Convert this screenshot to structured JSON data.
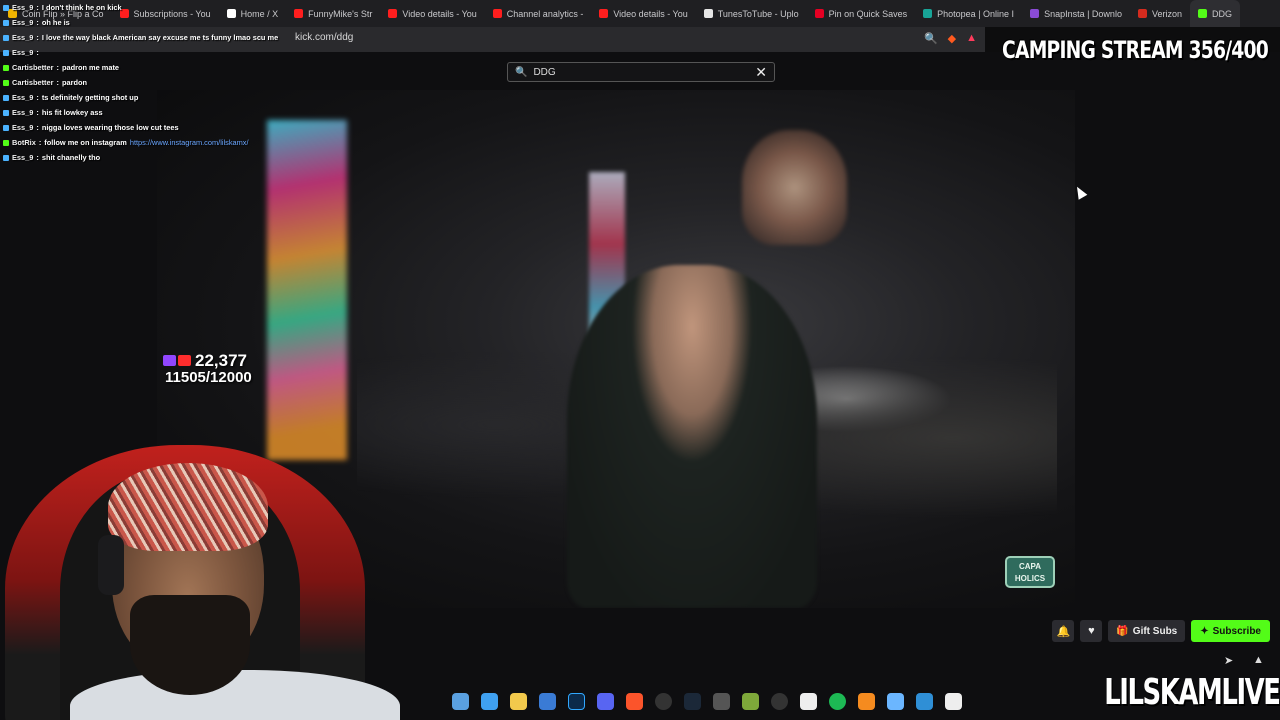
{
  "browser": {
    "tabs": [
      {
        "label": "Coin Flip » Flip a Co",
        "color": "#f0b400"
      },
      {
        "label": "Subscriptions - You",
        "color": "#ff1e1e"
      },
      {
        "label": "Home / X",
        "color": "#ffffff"
      },
      {
        "label": "FunnyMike's Str",
        "color": "#ff1e1e"
      },
      {
        "label": "Video details - You",
        "color": "#ff1e1e"
      },
      {
        "label": "Channel analytics -",
        "color": "#ff1e1e"
      },
      {
        "label": "Video details - You",
        "color": "#ff1e1e"
      },
      {
        "label": "TunesToTube - Uplo",
        "color": "#e6e6e6"
      },
      {
        "label": "Pin on Quick Saves",
        "color": "#e60023"
      },
      {
        "label": "Photopea | Online I",
        "color": "#18a497"
      },
      {
        "label": "SnapInsta | Downlo",
        "color": "#8a4bd6"
      },
      {
        "label": "Verizon",
        "color": "#d52b1e"
      },
      {
        "label": "DDG",
        "color": "#53fc18"
      }
    ],
    "url": "kick.com/ddg"
  },
  "search": {
    "value": "DDG"
  },
  "chat": {
    "messages": [
      {
        "user": "Ess_9",
        "text": "I don't think he on kick",
        "badge": "#4bb3ff"
      },
      {
        "user": "Ess_9",
        "text": "oh he is",
        "badge": "#4bb3ff"
      },
      {
        "user": "Ess_9",
        "text": "I love the way black American say excuse me ts funny lmao scu me",
        "badge": "#4bb3ff"
      },
      {
        "user": "Ess_9",
        "text": "",
        "badge": "#4bb3ff"
      },
      {
        "user": "Cartisbetter",
        "text": "padron me mate",
        "badge": "#53fc18"
      },
      {
        "user": "Cartisbetter",
        "text": "pardon",
        "badge": "#53fc18"
      },
      {
        "user": "Ess_9",
        "text": "ts definitely getting shot up",
        "badge": "#4bb3ff"
      },
      {
        "user": "Ess_9",
        "text": "his fit lowkey ass",
        "badge": "#4bb3ff"
      },
      {
        "user": "Ess_9",
        "text": "nigga loves wearing those low cut tees",
        "badge": "#4bb3ff"
      },
      {
        "user": "BotRix",
        "text": "follow me on instagram",
        "link": "https://www.instagram.com/lilskamx/",
        "badge": "#53fc18"
      },
      {
        "user": "Ess_9",
        "text": "shit chanelly tho",
        "badge": "#4bb3ff"
      }
    ]
  },
  "overlay": {
    "title": "CAMPING STREAM 356/400",
    "brand": "LILSKAMLIVE"
  },
  "video": {
    "viewer_count": "22,377",
    "sub_goal": "11505/12000",
    "logo_text": "CAPA HOLICS"
  },
  "actions": {
    "gift_label": "Gift Subs",
    "subscribe_label": "Subscribe"
  }
}
